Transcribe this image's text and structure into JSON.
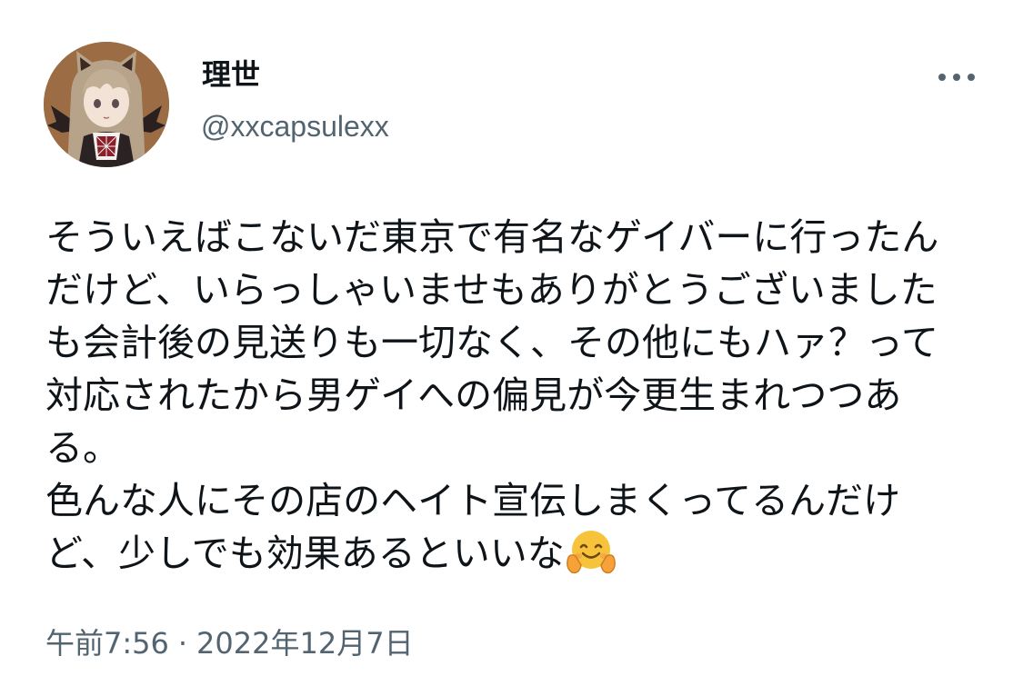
{
  "tweet": {
    "author": {
      "display_name": "理世",
      "handle": "@xxcapsulexx"
    },
    "more_icon": "more-horizontal-icon",
    "text": "そういえばこないだ東京で有名なゲイバーに行ったんだけど、いらっしゃいませもありがとうございましたも会計後の見送りも一切なく、その他にもハァ？って対応されたから男ゲイへの偏見が今更生まれつつある。\n色んな人にその店のヘイト宣伝しまくってるんだけど、少しでも効果あるといいな",
    "emoji": "hugging-face-icon",
    "time": "午前7:56",
    "separator": "·",
    "date": "2022年12月7日"
  },
  "colors": {
    "text": "#0f1419",
    "secondary": "#536471",
    "background": "#ffffff"
  }
}
